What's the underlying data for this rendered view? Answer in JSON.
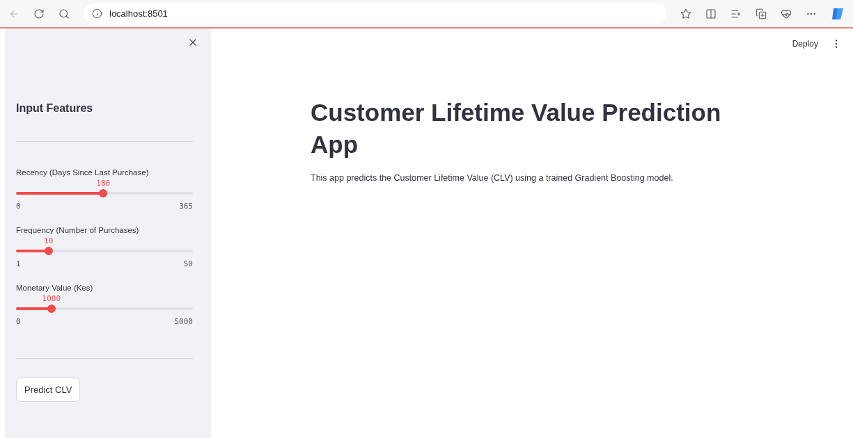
{
  "browser": {
    "url": "localhost:8501"
  },
  "sidebar": {
    "title": "Input Features",
    "sliders": [
      {
        "label": "Recency (Days Since Last Purchase)",
        "value": "180",
        "min": "0",
        "max": "365",
        "level": 0.493
      },
      {
        "label": "Frequency (Number of Purchases)",
        "value": "10",
        "min": "1",
        "max": "50",
        "level": 0.184
      },
      {
        "label": "Monetary Value (Kes)",
        "value": "1000",
        "min": "0",
        "max": "5000",
        "level": 0.2
      }
    ],
    "button": "Predict CLV"
  },
  "header": {
    "deploy": "Deploy"
  },
  "main": {
    "title": "Customer Lifetime Value Prediction App",
    "description": "This app predicts the Customer Lifetime Value (CLV) using a trained Gradient Boosting model."
  }
}
